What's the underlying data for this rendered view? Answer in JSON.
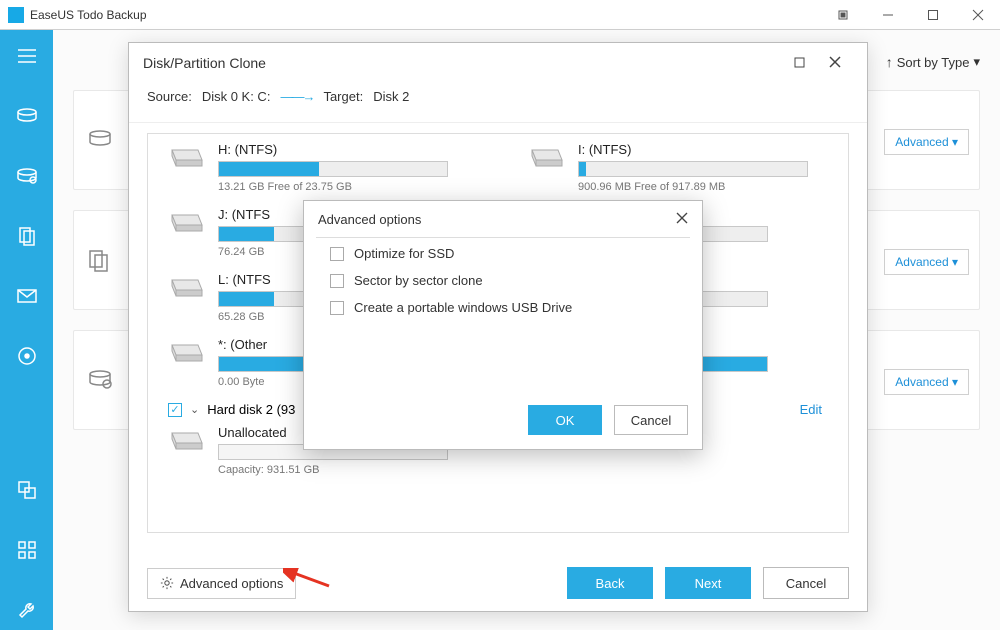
{
  "app": {
    "title": "EaseUS Todo Backup"
  },
  "topbar": {
    "sort": "Sort by Type"
  },
  "bgcards": {
    "advanced": "Advanced"
  },
  "clone": {
    "title": "Disk/Partition Clone",
    "source_label": "Source:",
    "source_value": "Disk 0 K: C:",
    "target_label": "Target:",
    "target_value": "Disk 2",
    "partitions": {
      "h": {
        "name": "H: (NTFS)",
        "free": "13.21 GB Free of 23.75 GB"
      },
      "i": {
        "name": "I: (NTFS)",
        "free": "900.96 MB Free of 917.89 MB"
      },
      "j": {
        "name": "J: (NTFS",
        "free": "76.24 GB"
      },
      "l": {
        "name": "L: (NTFS",
        "free": "65.28 GB"
      },
      "other": {
        "name": "*: (Other",
        "free": "0.00 Byte"
      }
    },
    "hd2": {
      "label": "Hard disk 2 (93",
      "edit": "Edit"
    },
    "unalloc": {
      "name": "Unallocated",
      "cap": "Capacity: 931.51 GB"
    },
    "adv_opt_btn": "Advanced options",
    "buttons": {
      "back": "Back",
      "next": "Next",
      "cancel": "Cancel"
    }
  },
  "advpopup": {
    "title": "Advanced options",
    "opt1": "Optimize for SSD",
    "opt2": "Sector by sector clone",
    "opt3": "Create a portable windows USB Drive",
    "ok": "OK",
    "cancel": "Cancel"
  }
}
